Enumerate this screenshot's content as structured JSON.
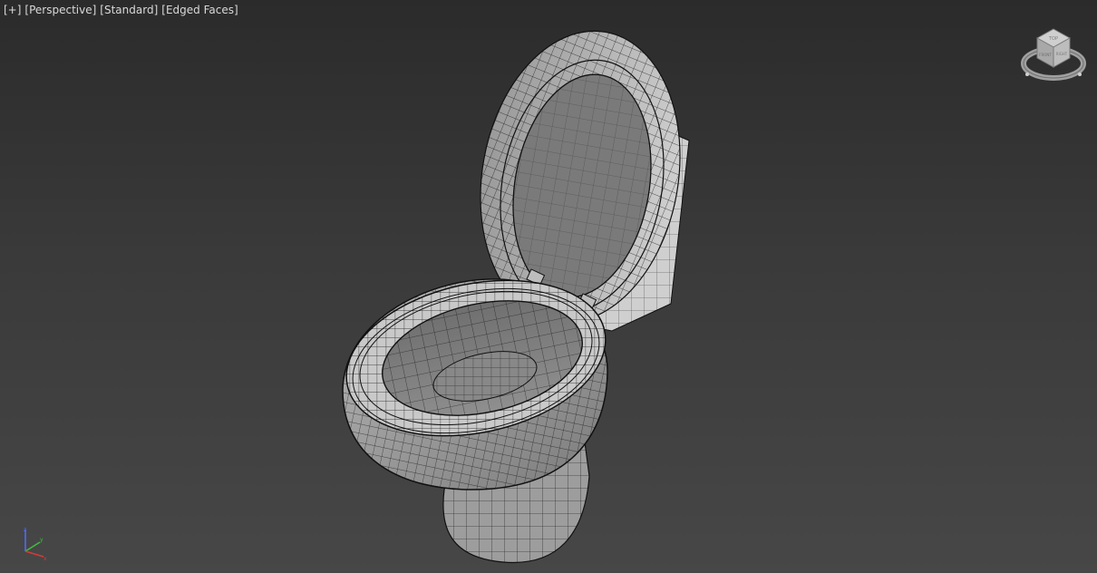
{
  "viewport": {
    "menu_plus": "[+]",
    "view_mode": "[Perspective]",
    "shading_mode": "[Standard]",
    "display_mode": "[Edged Faces]"
  },
  "viewcube": {
    "icon": "viewcube-icon",
    "face_top_label": "TOP",
    "face_front_label": "FRONT",
    "face_right_label": "RIGHT"
  },
  "axis_tripod": {
    "icon": "axis-tripod-icon",
    "x_color": "#d33b3b",
    "y_color": "#3fbf3f",
    "z_color": "#4f6fff"
  },
  "scene": {
    "object_icon": "toilet-mesh-icon",
    "mesh_color": "#a9a9a9",
    "edge_color": "#111111"
  }
}
